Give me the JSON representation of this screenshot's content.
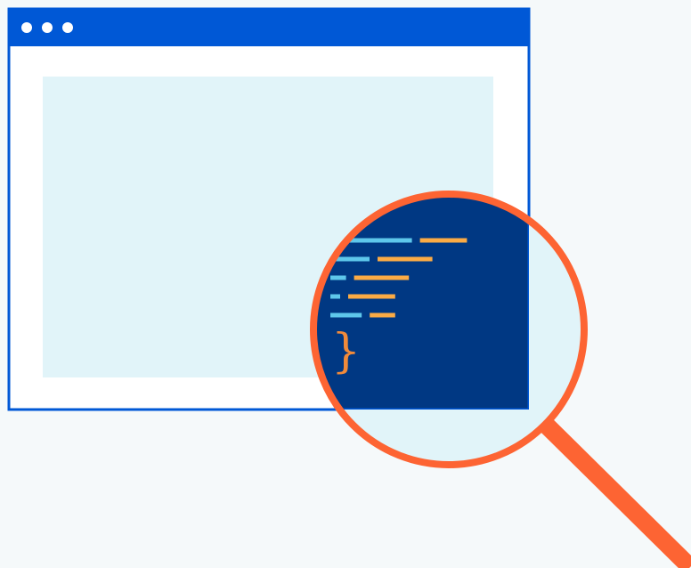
{
  "illustration": {
    "browser_window": {
      "titlebar_dots": [
        "dot-1",
        "dot-2",
        "dot-3"
      ],
      "frame_color": "#0058d6",
      "titlebar_color": "#0058d6",
      "content_color": "#e1f4f9",
      "body_color": "#ffffff"
    },
    "magnifier": {
      "rim_color": "#fd6433",
      "handle_color": "#fd6433",
      "lens_color": "#e1f4f9",
      "code_background": "#003883",
      "code_lines": [
        {
          "key_width": 0.33,
          "value_width": 0.24
        },
        {
          "key_width": 0.2,
          "value_width": 0.28
        },
        {
          "key_width": 0.08,
          "value_width": 0.28
        },
        {
          "key_width": 0.05,
          "value_width": 0.24
        },
        {
          "key_width": 0.16,
          "value_width": 0.13
        }
      ],
      "key_color": "#5ec7eb",
      "value_color": "#fbab45",
      "closing_brace": "}"
    }
  }
}
